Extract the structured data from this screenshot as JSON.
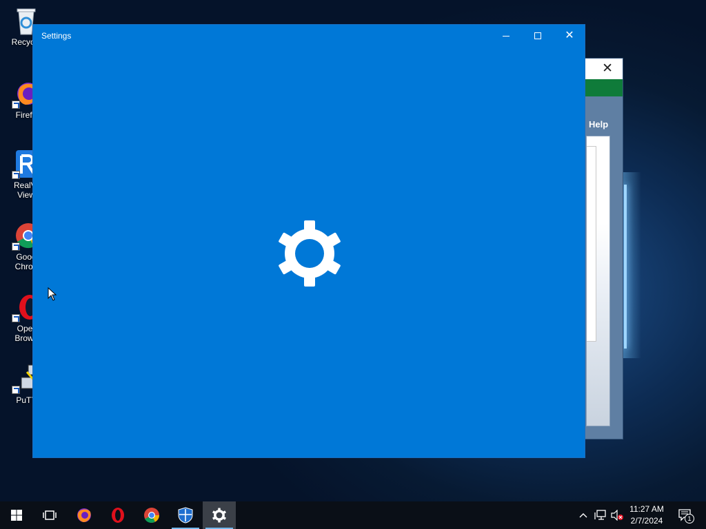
{
  "desktop": {
    "icons": [
      {
        "label_line1": "Recycle",
        "label_line2": "",
        "icon": "recycle-bin-icon"
      },
      {
        "label_line1": "Firefo",
        "label_line2": "",
        "icon": "firefox-icon"
      },
      {
        "label_line1": "RealVI",
        "label_line2": "View",
        "icon": "realvnc-viewer-icon"
      },
      {
        "label_line1": "Goog",
        "label_line2": "Chron",
        "icon": "google-chrome-icon"
      },
      {
        "label_line1": "Oper",
        "label_line2": "Brows",
        "icon": "opera-browser-icon"
      },
      {
        "label_line1": "PuTT",
        "label_line2": "",
        "icon": "putty-icon"
      }
    ]
  },
  "background_window": {
    "menu_help": "Help",
    "close": "✕"
  },
  "settings_window": {
    "title": "Settings",
    "close": "✕",
    "accent_color": "#0078d7"
  },
  "taskbar": {
    "start_icon": "windows-start-icon",
    "task_view_icon": "task-view-icon",
    "pinned": [
      "firefox-icon",
      "opera-icon",
      "chrome-icon",
      "windows-security-icon",
      "settings-gear-icon"
    ],
    "tray": {
      "chevron": "^",
      "notifications_count": "1"
    },
    "time": "11:27 AM",
    "date": "2/7/2024"
  }
}
